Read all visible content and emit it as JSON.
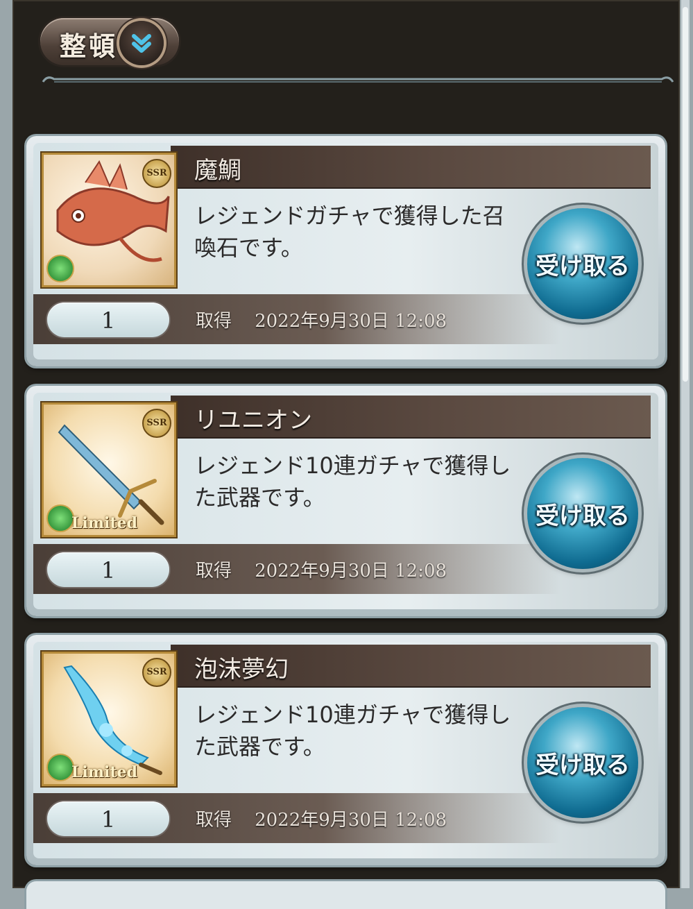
{
  "header": {
    "sort_label": "整頓",
    "sort_icon": "double-chevron-down-icon"
  },
  "items": [
    {
      "name": "魔鯛",
      "rarity": "SSR",
      "element_icon": "wind-element-icon",
      "limited": "",
      "description": "レジェンドガチャで獲得した召喚石です。",
      "quantity": "1",
      "acquired_label": "取得",
      "acquired_date": "2022年9月30日 12:08",
      "receive_label": "受け取る"
    },
    {
      "name": "リユニオン",
      "rarity": "SSR",
      "element_icon": "wind-element-icon",
      "limited": "Limited",
      "description": "レジェンド10連ガチャで獲得した武器です。",
      "quantity": "1",
      "acquired_label": "取得",
      "acquired_date": "2022年9月30日 12:08",
      "receive_label": "受け取る"
    },
    {
      "name": "泡沫夢幻",
      "rarity": "SSR",
      "element_icon": "wind-element-icon",
      "limited": "Limited",
      "description": "レジェンド10連ガチャで獲得した武器です。",
      "quantity": "1",
      "acquired_label": "取得",
      "acquired_date": "2022年9月30日 12:08",
      "receive_label": "受け取る"
    }
  ],
  "colors": {
    "receive_button": "#1f86aa",
    "title_bar": "#4e3e36",
    "frame": "#23201b"
  }
}
